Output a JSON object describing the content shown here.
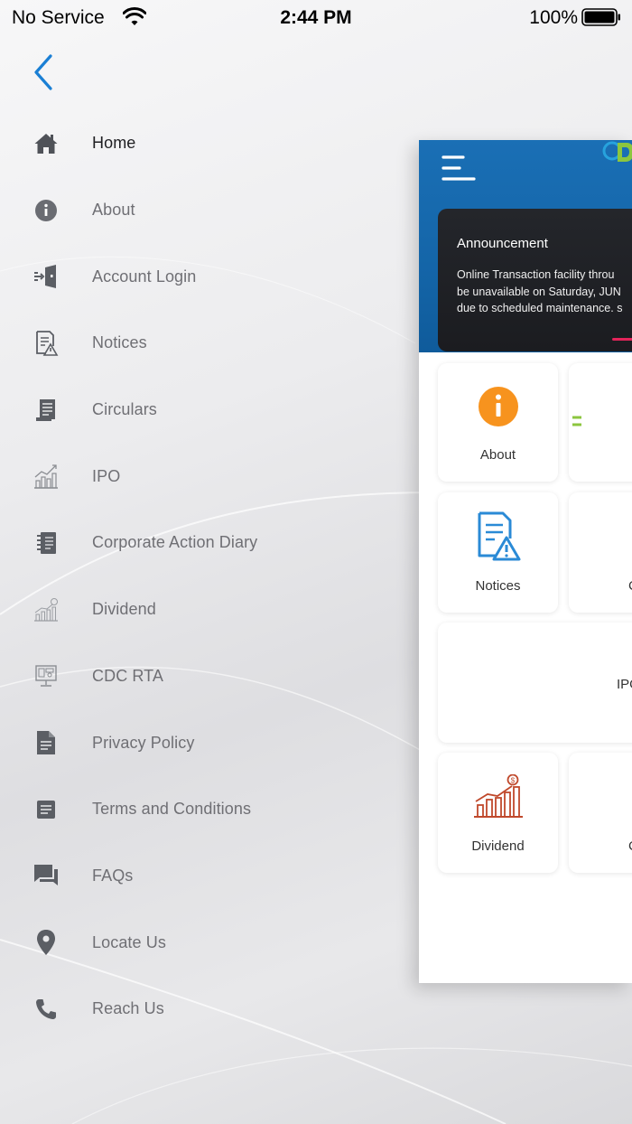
{
  "status_bar": {
    "carrier": "No Service",
    "time": "2:44 PM",
    "battery": "100%"
  },
  "menu": {
    "items": [
      {
        "label": "Home",
        "icon": "home-icon",
        "active": true
      },
      {
        "label": "About",
        "icon": "info-icon"
      },
      {
        "label": "Account Login",
        "icon": "login-door-icon"
      },
      {
        "label": "Notices",
        "icon": "notice-document-icon"
      },
      {
        "label": "Circulars",
        "icon": "circular-document-icon"
      },
      {
        "label": "IPO",
        "icon": "ipo-chart-icon"
      },
      {
        "label": "Corporate Action Diary",
        "icon": "diary-icon"
      },
      {
        "label": "Dividend",
        "icon": "dividend-chart-icon"
      },
      {
        "label": "CDC RTA",
        "icon": "rta-monitor-icon"
      },
      {
        "label": "Privacy Policy",
        "icon": "privacy-document-icon"
      },
      {
        "label": "Terms and Conditions",
        "icon": "terms-icon"
      },
      {
        "label": "FAQs",
        "icon": "chat-bubbles-icon"
      },
      {
        "label": "Locate Us",
        "icon": "location-pin-icon"
      },
      {
        "label": "Reach Us",
        "icon": "phone-icon"
      }
    ]
  },
  "preview": {
    "announcement": {
      "title": "Announcement",
      "line1": "Online Transaction facility throu",
      "line2": "be unavailable on Saturday, JUN",
      "line3": "due to scheduled maintenance. s"
    },
    "tiles": {
      "about": "About",
      "notices": "Notices",
      "ipo": "IPO",
      "dividend": "Dividend",
      "right_clip_notices": "C",
      "right_clip_dividend": "C"
    }
  },
  "colors": {
    "accent_blue": "#1a6fb5",
    "back_chevron": "#1a7fd4",
    "about_orange": "#f7931e",
    "notices_blue": "#2a8ad6",
    "dividend_red": "#c0492c",
    "announce_accent": "#e3245a"
  }
}
